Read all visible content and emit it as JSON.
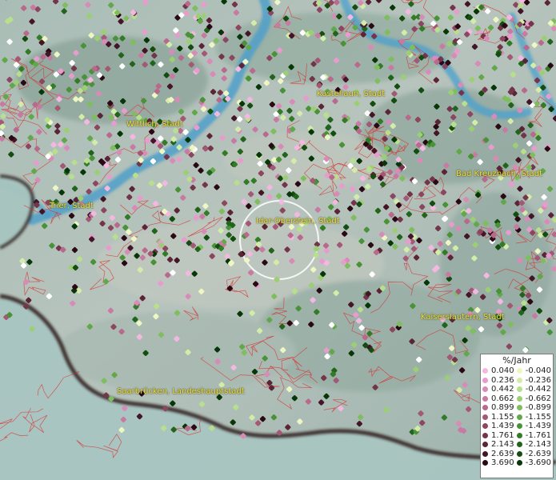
{
  "map": {
    "cities": [
      {
        "id": "kastellaun",
        "label": "Kastellaun, Stadt"
      },
      {
        "id": "wittlich",
        "label": "Wittlich, Stadt"
      },
      {
        "id": "bad-kreuznach",
        "label": "Bad Kreuznach, Stadt"
      },
      {
        "id": "trier",
        "label": "Trier, Stadt"
      },
      {
        "id": "idar-oberstein",
        "label": "Idar-Oberstein, Stadt"
      },
      {
        "id": "kaiserslautern",
        "label": "Kaiserslautern, Stadt"
      },
      {
        "id": "saarbruecken",
        "label": "Saarbrücken, Landeshauptstadt"
      }
    ]
  },
  "legend": {
    "title": "%/Jahr",
    "positive": [
      {
        "value": "0.040",
        "color": "#f4b8e0"
      },
      {
        "value": "0.236",
        "color": "#e89ccd"
      },
      {
        "value": "0.442",
        "color": "#d98bb8"
      },
      {
        "value": "0.662",
        "color": "#c97aa2"
      },
      {
        "value": "0.899",
        "color": "#b8698c"
      },
      {
        "value": "1.155",
        "color": "#a35876"
      },
      {
        "value": "1.439",
        "color": "#8c4660"
      },
      {
        "value": "1.761",
        "color": "#74354b"
      },
      {
        "value": "2.143",
        "color": "#5c2437"
      },
      {
        "value": "2.639",
        "color": "#441526"
      },
      {
        "value": "3.690",
        "color": "#2a0814"
      }
    ],
    "negative": [
      {
        "value": "-0.040",
        "color": "#eef7c4"
      },
      {
        "value": "-0.236",
        "color": "#d3eda8"
      },
      {
        "value": "-0.442",
        "color": "#b8e08c"
      },
      {
        "value": "-0.662",
        "color": "#9ccf74"
      },
      {
        "value": "-0.899",
        "color": "#7fbd5e"
      },
      {
        "value": "-1.155",
        "color": "#62a84a"
      },
      {
        "value": "-1.439",
        "color": "#4a9238"
      },
      {
        "value": "-1.761",
        "color": "#347b28"
      },
      {
        "value": "-2.143",
        "color": "#22641b"
      },
      {
        "value": "-2.639",
        "color": "#134d10"
      },
      {
        "value": "-3.690",
        "color": "#073607"
      }
    ]
  }
}
